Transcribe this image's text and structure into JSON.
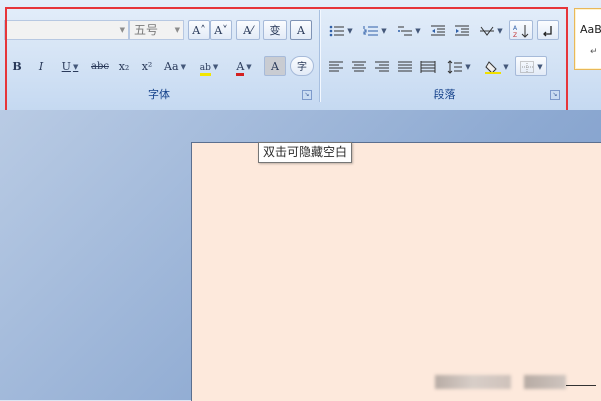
{
  "font_group": {
    "label": "字体",
    "font_name_value": "",
    "font_size_value": "五号",
    "row1": [
      {
        "name": "grow-font-button",
        "text": "A˄"
      },
      {
        "name": "shrink-font-button",
        "text": "A˅"
      },
      {
        "name": "clear-format-button",
        "text": "A⁄"
      },
      {
        "name": "phonetic-guide-button",
        "text": "变"
      },
      {
        "name": "char-border-button",
        "text": "A"
      }
    ],
    "row2": [
      {
        "name": "bold-button",
        "text": "B"
      },
      {
        "name": "italic-button",
        "text": "I"
      },
      {
        "name": "underline-button",
        "text": "U"
      },
      {
        "name": "strikethrough-button",
        "text": "abc"
      },
      {
        "name": "subscript-button",
        "text": "x₂"
      },
      {
        "name": "superscript-button",
        "text": "x²"
      },
      {
        "name": "change-case-button",
        "text": "Aa"
      },
      {
        "name": "highlight-color-button",
        "text": "ab"
      },
      {
        "name": "font-color-button",
        "text": "A"
      },
      {
        "name": "char-shading-button",
        "text": "A"
      },
      {
        "name": "enclose-char-button",
        "text": "字"
      }
    ]
  },
  "para_group": {
    "label": "段落"
  },
  "styles_gallery": {
    "sample": "AaB",
    "para_mark": "↵"
  },
  "tooltip": {
    "text": "双击可隐藏空白"
  },
  "colors": {
    "ribbon_label": "#15428b",
    "highlight_border": "#e6353a",
    "page_background": "#fde9dc"
  }
}
